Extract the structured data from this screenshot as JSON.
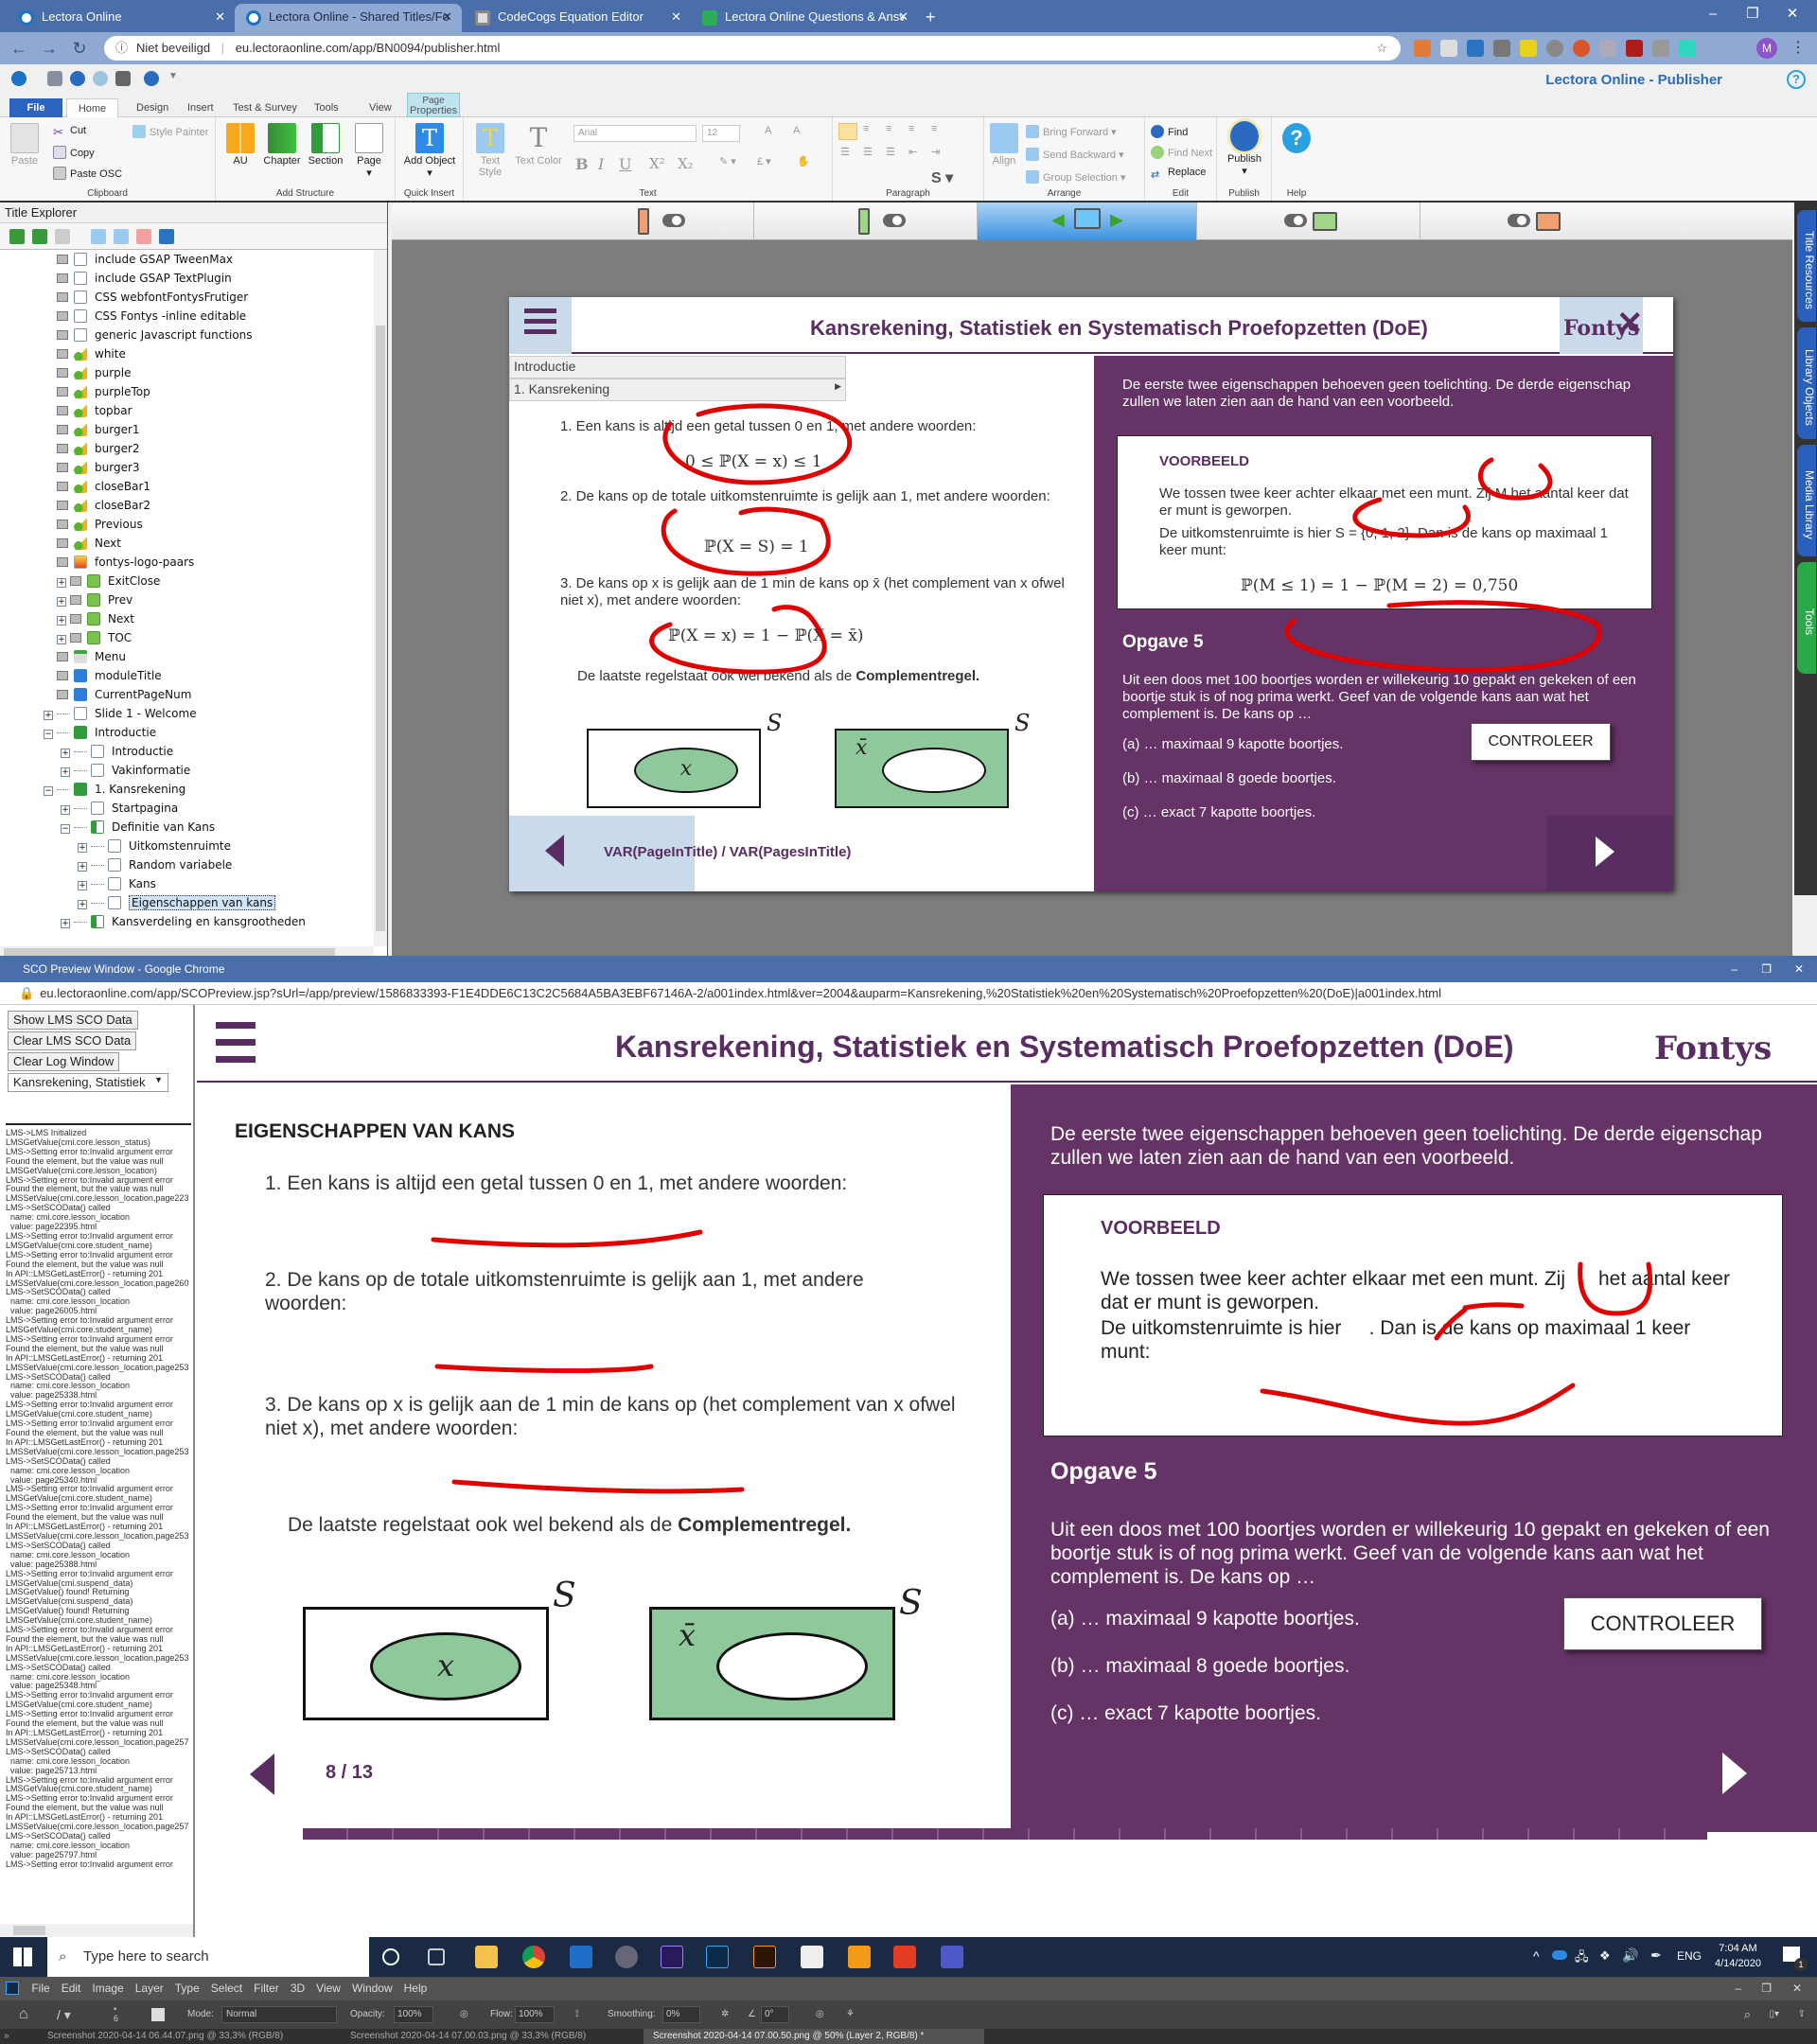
{
  "browser": {
    "tabs": [
      {
        "label": "Lectora Online",
        "active": false
      },
      {
        "label": "Lectora Online - Shared Titles/Fo",
        "active": true
      },
      {
        "label": "CodeCogs Equation Editor",
        "active": false
      },
      {
        "label": "Lectora Online Questions & Ansv",
        "active": false
      }
    ],
    "new_tab": "+",
    "security": "Niet beveiligd",
    "url": "eu.lectoraonline.com/app/BN0094/publisher.html",
    "profile_initial": "M",
    "window_controls": {
      "minimize": "–",
      "restore": "❐",
      "close": "✕"
    }
  },
  "app": {
    "title": "Lectora Online - Publisher",
    "help": "?",
    "ribbon_tabs": [
      "File",
      "Home",
      "Design",
      "Insert",
      "Test & Survey",
      "Tools",
      "View"
    ],
    "context_tab": {
      "top": "Page",
      "bottom": "Properties"
    },
    "groups": {
      "clipboard": {
        "label": "Clipboard",
        "paste": "Paste",
        "cut": "Cut",
        "copy": "Copy",
        "paste_osc": "Paste OSC",
        "style_painter": "Style Painter"
      },
      "add_structure": {
        "label": "Add Structure",
        "au": "AU",
        "chapter": "Chapter",
        "section": "Section",
        "page": "Page"
      },
      "quick_insert": {
        "label": "Quick Insert",
        "add_object": "Add Object"
      },
      "text": {
        "label": "Text",
        "text_style": "Text Style",
        "text_color": "Text Color",
        "font": "Arial",
        "size": "12",
        "bold": "B",
        "italic": "I",
        "underline": "U",
        "sup": "X²",
        "sub": "X₂"
      },
      "paragraph": {
        "label": "Paragraph"
      },
      "arrange": {
        "label": "Arrange",
        "align": "Align",
        "bring_forward": "Bring Forward",
        "send_backward": "Send Backward",
        "group_selection": "Group Selection"
      },
      "edit": {
        "label": "Edit",
        "find": "Find",
        "find_next": "Find Next",
        "replace": "Replace"
      },
      "publish": {
        "label": "Publish",
        "publish": "Publish"
      },
      "help": {
        "label": "Help"
      }
    },
    "right_panels": [
      "Title Resources",
      "Library Objects",
      "Media Library",
      "Tools"
    ]
  },
  "explorer": {
    "title": "Title Explorer",
    "nodes": [
      {
        "label": "include GSAP TweenMax",
        "icon": "doc",
        "level": 0,
        "expander": ""
      },
      {
        "label": "include GSAP TextPlugin",
        "icon": "doc",
        "level": 0,
        "expander": ""
      },
      {
        "label": "CSS webfontFontysFrutiger",
        "icon": "doc",
        "level": 0,
        "expander": ""
      },
      {
        "label": "CSS Fontys -inline editable",
        "icon": "doc",
        "level": 0,
        "expander": ""
      },
      {
        "label": "generic Javascript functions",
        "icon": "doc",
        "level": 0,
        "expander": ""
      },
      {
        "label": "white",
        "icon": "act",
        "level": 0,
        "expander": ""
      },
      {
        "label": "purple",
        "icon": "act",
        "level": 0,
        "expander": ""
      },
      {
        "label": "purpleTop",
        "icon": "act",
        "level": 0,
        "expander": ""
      },
      {
        "label": "topbar",
        "icon": "act",
        "level": 0,
        "expander": ""
      },
      {
        "label": "burger1",
        "icon": "act",
        "level": 0,
        "expander": ""
      },
      {
        "label": "burger2",
        "icon": "act",
        "level": 0,
        "expander": ""
      },
      {
        "label": "burger3",
        "icon": "act",
        "level": 0,
        "expander": ""
      },
      {
        "label": "closeBar1",
        "icon": "act",
        "level": 0,
        "expander": ""
      },
      {
        "label": "closeBar2",
        "icon": "act",
        "level": 0,
        "expander": ""
      },
      {
        "label": "Previous",
        "icon": "act",
        "level": 0,
        "expander": ""
      },
      {
        "label": "Next",
        "icon": "act",
        "level": 0,
        "expander": ""
      },
      {
        "label": "fontys-logo-paars",
        "icon": "img",
        "level": 0,
        "expander": ""
      },
      {
        "label": "ExitClose",
        "icon": "btn",
        "level": 0,
        "expander": "+"
      },
      {
        "label": "Prev",
        "icon": "btn",
        "level": 0,
        "expander": "+"
      },
      {
        "label": "Next",
        "icon": "btn",
        "level": 0,
        "expander": "+"
      },
      {
        "label": "TOC",
        "icon": "btn",
        "level": 0,
        "expander": "+"
      },
      {
        "label": "Menu",
        "icon": "menu",
        "level": 0,
        "expander": ""
      },
      {
        "label": "moduleTitle",
        "icon": "txt",
        "level": 0,
        "expander": ""
      },
      {
        "label": "CurrentPageNum",
        "icon": "txt",
        "level": 0,
        "expander": ""
      },
      {
        "label": "Slide 1 - Welcome",
        "icon": "doc",
        "level": 0,
        "expander": "+",
        "nobox": true
      },
      {
        "label": "Introductie",
        "icon": "chap",
        "level": 0,
        "expander": "−",
        "nobox": true
      },
      {
        "label": "Introductie",
        "icon": "doc",
        "level": 1,
        "expander": "+",
        "nobox": true
      },
      {
        "label": "Vakinformatie",
        "icon": "doc",
        "level": 1,
        "expander": "+",
        "nobox": true
      },
      {
        "label": "1. Kansrekening",
        "icon": "chap",
        "level": 0,
        "expander": "−",
        "nobox": true
      },
      {
        "label": "Startpagina",
        "icon": "doc",
        "level": 1,
        "expander": "+",
        "nobox": true
      },
      {
        "label": "Definitie van Kans",
        "icon": "sect",
        "level": 1,
        "expander": "−",
        "nobox": true
      },
      {
        "label": "Uitkomstenruimte",
        "icon": "doc",
        "level": 2,
        "expander": "+",
        "nobox": true
      },
      {
        "label": "Random variabele",
        "icon": "doc",
        "level": 2,
        "expander": "+",
        "nobox": true
      },
      {
        "label": "Kans",
        "icon": "doc",
        "level": 2,
        "expander": "+",
        "nobox": true
      },
      {
        "label": "Eigenschappen van kans",
        "icon": "doc",
        "level": 2,
        "expander": "+",
        "nobox": true,
        "selected": true
      },
      {
        "label": "Kansverdeling en kansgrootheden",
        "icon": "sect",
        "level": 1,
        "expander": "+",
        "nobox": true
      }
    ]
  },
  "slide": {
    "course_title": "Kansrekening, Statistiek en Systematisch Proefopzetten (DoE)",
    "logo_text": "Fontys",
    "menu_items": [
      "Introductie",
      "1. Kansrekening"
    ],
    "page_heading": "EIGENSCHAPPEN VAN KANS",
    "items": [
      "1. Een kans is altijd een getal tussen 0 en 1, met andere woorden:",
      "2. De kans op de totale uitkomstenruimte is gelijk aan 1, met andere woorden:",
      "3. De kans op x is gelijk aan de 1 min de kans op x̄ (het complement van x ofwel niet x), met andere woorden:"
    ],
    "item3_preview": "3. De kans op x is gelijk aan de 1 min de kans op     (het complement van x ofwel niet x), met andere woorden:",
    "formulas": [
      "0 ≤ ℙ(X = x) ≤ 1",
      "ℙ(X = S) = 1",
      "ℙ(X = x) = 1 − ℙ(X = x̄)"
    ],
    "complement_note_prefix": "De laatste regelstaat ook wel bekend als de ",
    "complement_note_bold": "Complementregel.",
    "venn": {
      "set_label": "S",
      "event": "x",
      "complement": "x̄"
    },
    "right_intro": "De eerste twee eigenschappen behoeven geen toelichting. De derde eigenschap zullen we laten zien aan de hand van een voorbeeld.",
    "example": {
      "title": "VOORBEELD",
      "line1": "We tossen twee keer achter elkaar met een munt. Zij M het aantal keer dat er munt is geworpen.",
      "line1_preview": "We tossen twee keer achter elkaar met een munt. Zij      het aantal keer dat er munt is geworpen.",
      "line2": "De uitkomstenruimte is hier S = {0, 1, 2}. Dan is de kans op maximaal 1 keer munt:",
      "line2_preview": "De uitkomstenruimte is hier     . Dan is de kans op maximaal 1 keer munt:",
      "formula": "ℙ(M ≤ 1) = 1 − ℙ(M = 2) = 0,750"
    },
    "exercise": {
      "title": "Opgave 5",
      "text": "Uit een doos met 100 boortjes worden er willekeurig 10 gepakt en gekeken of een boortje stuk is of nog prima werkt. Geef van de volgende kans aan wat het complement is. De kans op …",
      "options": [
        "(a) … maximaal 9 kapotte boortjes.",
        "(b) … maximaal 8 goede boortjes.",
        "(c) … exact 7 kapotte boortjes."
      ],
      "check_button": "CONTROLEER"
    },
    "editor_page_var": "VAR(PageInTitle) / VAR(PagesInTitle)",
    "preview_page": "8 / 13"
  },
  "preview_window": {
    "title": "SCO Preview Window - Google Chrome",
    "url": "eu.lectoraonline.com/app/SCOPreview.jsp?sUrl=/app/preview/1586833393-F1E4DDE6C13C2C5684A5BA3EBF67146A-2/a001index.html&ver=2004&auparm=Kansrekening,%20Statistiek%20en%20Systematisch%20Proefopzetten%20(DoE)|a001index.html",
    "buttons": [
      "Show LMS SCO Data",
      "Clear LMS SCO Data",
      "Clear Log Window"
    ],
    "select_value": "Kansrekening, Statistiek",
    "log": "LMS->LMS Initialized\nLMSGetValue(cmi.core.lesson_status)\nLMS->Setting error to:Invalid argument error\nFound the element, but the value was null\nLMSGetValue(cmi.core.lesson_location)\nLMS->Setting error to:Invalid argument error\nFound the element, but the value was null\nLMSSetValue(cmi.core.lesson_location,page223\nLMS->SetSCOData() called\n  name: cmi.core.lesson_location\n  value: page22395.html\nLMS->Setting error to:Invalid argument error\nLMSGetValue(cmi.core.student_name)\nLMS->Setting error to:Invalid argument error\nFound the element, but the value was null\nIn API::LMSGetLastError() - returning 201\nLMSSetValue(cmi.core.lesson_location,page260\nLMS->SetSCOData() called\n  name: cmi.core.lesson_location\n  value: page26005.html\nLMS->Setting error to:Invalid argument error\nLMSGetValue(cmi.core.student_name)\nLMS->Setting error to:Invalid argument error\nFound the element, but the value was null\nIn API::LMSGetLastError() - returning 201\nLMSSetValue(cmi.core.lesson_location,page253\nLMS->SetSCOData() called\n  name: cmi.core.lesson_location\n  value: page25338.html\nLMS->Setting error to:Invalid argument error\nLMSGetValue(cmi.core.student_name)\nLMS->Setting error to:Invalid argument error\nFound the element, but the value was null\nIn API::LMSGetLastError() - returning 201\nLMSSetValue(cmi.core.lesson_location,page253\nLMS->SetSCOData() called\n  name: cmi.core.lesson_location\n  value: page25340.html\nLMS->Setting error to:Invalid argument error\nLMSGetValue(cmi.core.student_name)\nLMS->Setting error to:Invalid argument error\nFound the element, but the value was null\nIn API::LMSGetLastError() - returning 201\nLMSSetValue(cmi.core.lesson_location,page253\nLMS->SetSCOData() called\n  name: cmi.core.lesson_location\n  value: page25388.html\nLMS->Setting error to:Invalid argument error\nLMSGetValue(cmi.suspend_data)\nLMSGetValue() found! Returning\nLMSGetValue(cmi.suspend_data)\nLMSGetValue() found! Returning\nLMSGetValue(cmi.core.student_name)\nLMS->Setting error to:Invalid argument error\nFound the element, but the value was null\nIn API::LMSGetLastError() - returning 201\nLMSSetValue(cmi.core.lesson_location,page253\nLMS->SetSCOData() called\n  name: cmi.core.lesson_location\n  value: page25348.html\nLMS->Setting error to:Invalid argument error\nLMSGetValue(cmi.core.student_name)\nLMS->Setting error to:Invalid argument error\nFound the element, but the value was null\nIn API::LMSGetLastError() - returning 201\nLMSSetValue(cmi.core.lesson_location,page257\nLMS->SetSCOData() called\n  name: cmi.core.lesson_location\n  value: page25713.html\nLMS->Setting error to:Invalid argument error\nLMSGetValue(cmi.core.student_name)\nLMS->Setting error to:Invalid argument error\nFound the element, but the value was null\nIn API::LMSGetLastError() - returning 201\nLMSSetValue(cmi.core.lesson_location,page257\nLMS->SetSCOData() called\n  name: cmi.core.lesson_location\n  value: page25797.html\nLMS->Setting error to:Invalid argument error"
  },
  "taskbar": {
    "search_placeholder": "Type here to search",
    "language": "ENG",
    "time": "7:04 AM",
    "date": "4/14/2020",
    "notifications": "1"
  },
  "photoshop": {
    "menu": [
      "File",
      "Edit",
      "Image",
      "Layer",
      "Type",
      "Select",
      "Filter",
      "3D",
      "View",
      "Window",
      "Help"
    ],
    "mode_label": "Mode:",
    "mode_value": "Normal",
    "opacity_label": "Opacity:",
    "opacity_value": "100%",
    "flow_label": "Flow:",
    "flow_value": "100%",
    "smoothing_label": "Smoothing:",
    "smoothing_value": "0%",
    "angle_value": "0°",
    "brush_size": "6",
    "doc_tabs": [
      "Screenshot 2020-04-14 06.44.07.png @ 33,3% (RGB/8)",
      "Screenshot 2020-04-14 07.00.03.png @ 33,3% (RGB/8)",
      "Screenshot 2020-04-14 07.00.50.png @ 50% (Layer 2, RGB/8) *"
    ]
  },
  "colors": {
    "brand_purple": "#663366",
    "title_purple": "#5a2d62",
    "venn_green": "#8fc89b",
    "ink_red": "#e00000",
    "chrome_blue": "#4a6ea9"
  }
}
